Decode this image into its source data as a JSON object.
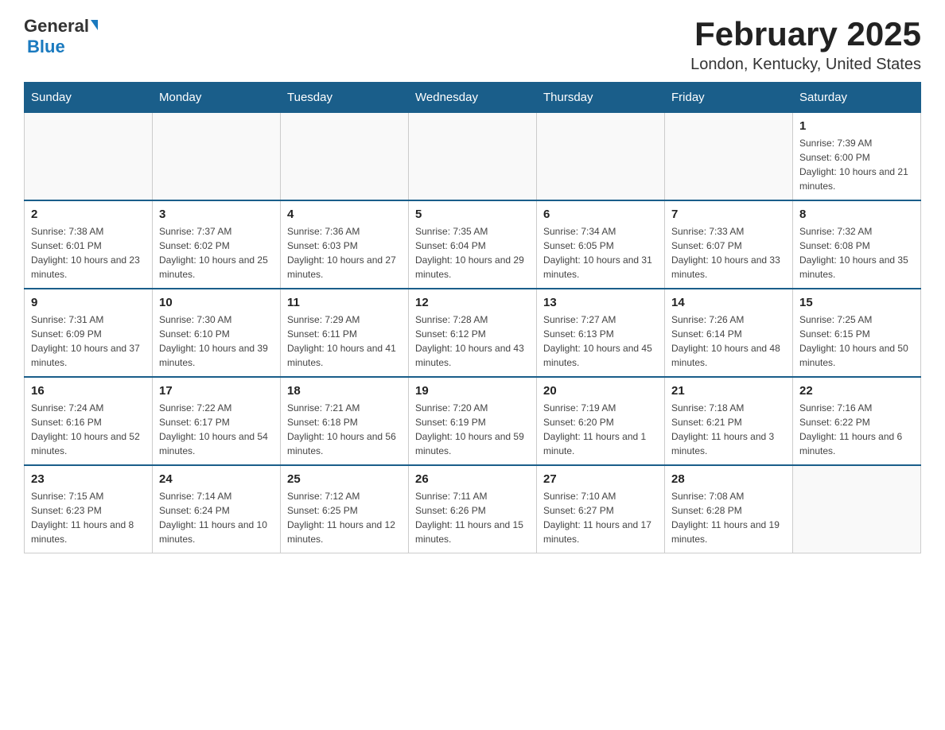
{
  "header": {
    "logo_text_general": "General",
    "logo_text_blue": "Blue",
    "month_title": "February 2025",
    "location": "London, Kentucky, United States"
  },
  "days_of_week": [
    "Sunday",
    "Monday",
    "Tuesday",
    "Wednesday",
    "Thursday",
    "Friday",
    "Saturday"
  ],
  "weeks": [
    [
      {
        "day": "",
        "info": ""
      },
      {
        "day": "",
        "info": ""
      },
      {
        "day": "",
        "info": ""
      },
      {
        "day": "",
        "info": ""
      },
      {
        "day": "",
        "info": ""
      },
      {
        "day": "",
        "info": ""
      },
      {
        "day": "1",
        "info": "Sunrise: 7:39 AM\nSunset: 6:00 PM\nDaylight: 10 hours and 21 minutes."
      }
    ],
    [
      {
        "day": "2",
        "info": "Sunrise: 7:38 AM\nSunset: 6:01 PM\nDaylight: 10 hours and 23 minutes."
      },
      {
        "day": "3",
        "info": "Sunrise: 7:37 AM\nSunset: 6:02 PM\nDaylight: 10 hours and 25 minutes."
      },
      {
        "day": "4",
        "info": "Sunrise: 7:36 AM\nSunset: 6:03 PM\nDaylight: 10 hours and 27 minutes."
      },
      {
        "day": "5",
        "info": "Sunrise: 7:35 AM\nSunset: 6:04 PM\nDaylight: 10 hours and 29 minutes."
      },
      {
        "day": "6",
        "info": "Sunrise: 7:34 AM\nSunset: 6:05 PM\nDaylight: 10 hours and 31 minutes."
      },
      {
        "day": "7",
        "info": "Sunrise: 7:33 AM\nSunset: 6:07 PM\nDaylight: 10 hours and 33 minutes."
      },
      {
        "day": "8",
        "info": "Sunrise: 7:32 AM\nSunset: 6:08 PM\nDaylight: 10 hours and 35 minutes."
      }
    ],
    [
      {
        "day": "9",
        "info": "Sunrise: 7:31 AM\nSunset: 6:09 PM\nDaylight: 10 hours and 37 minutes."
      },
      {
        "day": "10",
        "info": "Sunrise: 7:30 AM\nSunset: 6:10 PM\nDaylight: 10 hours and 39 minutes."
      },
      {
        "day": "11",
        "info": "Sunrise: 7:29 AM\nSunset: 6:11 PM\nDaylight: 10 hours and 41 minutes."
      },
      {
        "day": "12",
        "info": "Sunrise: 7:28 AM\nSunset: 6:12 PM\nDaylight: 10 hours and 43 minutes."
      },
      {
        "day": "13",
        "info": "Sunrise: 7:27 AM\nSunset: 6:13 PM\nDaylight: 10 hours and 45 minutes."
      },
      {
        "day": "14",
        "info": "Sunrise: 7:26 AM\nSunset: 6:14 PM\nDaylight: 10 hours and 48 minutes."
      },
      {
        "day": "15",
        "info": "Sunrise: 7:25 AM\nSunset: 6:15 PM\nDaylight: 10 hours and 50 minutes."
      }
    ],
    [
      {
        "day": "16",
        "info": "Sunrise: 7:24 AM\nSunset: 6:16 PM\nDaylight: 10 hours and 52 minutes."
      },
      {
        "day": "17",
        "info": "Sunrise: 7:22 AM\nSunset: 6:17 PM\nDaylight: 10 hours and 54 minutes."
      },
      {
        "day": "18",
        "info": "Sunrise: 7:21 AM\nSunset: 6:18 PM\nDaylight: 10 hours and 56 minutes."
      },
      {
        "day": "19",
        "info": "Sunrise: 7:20 AM\nSunset: 6:19 PM\nDaylight: 10 hours and 59 minutes."
      },
      {
        "day": "20",
        "info": "Sunrise: 7:19 AM\nSunset: 6:20 PM\nDaylight: 11 hours and 1 minute."
      },
      {
        "day": "21",
        "info": "Sunrise: 7:18 AM\nSunset: 6:21 PM\nDaylight: 11 hours and 3 minutes."
      },
      {
        "day": "22",
        "info": "Sunrise: 7:16 AM\nSunset: 6:22 PM\nDaylight: 11 hours and 6 minutes."
      }
    ],
    [
      {
        "day": "23",
        "info": "Sunrise: 7:15 AM\nSunset: 6:23 PM\nDaylight: 11 hours and 8 minutes."
      },
      {
        "day": "24",
        "info": "Sunrise: 7:14 AM\nSunset: 6:24 PM\nDaylight: 11 hours and 10 minutes."
      },
      {
        "day": "25",
        "info": "Sunrise: 7:12 AM\nSunset: 6:25 PM\nDaylight: 11 hours and 12 minutes."
      },
      {
        "day": "26",
        "info": "Sunrise: 7:11 AM\nSunset: 6:26 PM\nDaylight: 11 hours and 15 minutes."
      },
      {
        "day": "27",
        "info": "Sunrise: 7:10 AM\nSunset: 6:27 PM\nDaylight: 11 hours and 17 minutes."
      },
      {
        "day": "28",
        "info": "Sunrise: 7:08 AM\nSunset: 6:28 PM\nDaylight: 11 hours and 19 minutes."
      },
      {
        "day": "",
        "info": ""
      }
    ]
  ]
}
